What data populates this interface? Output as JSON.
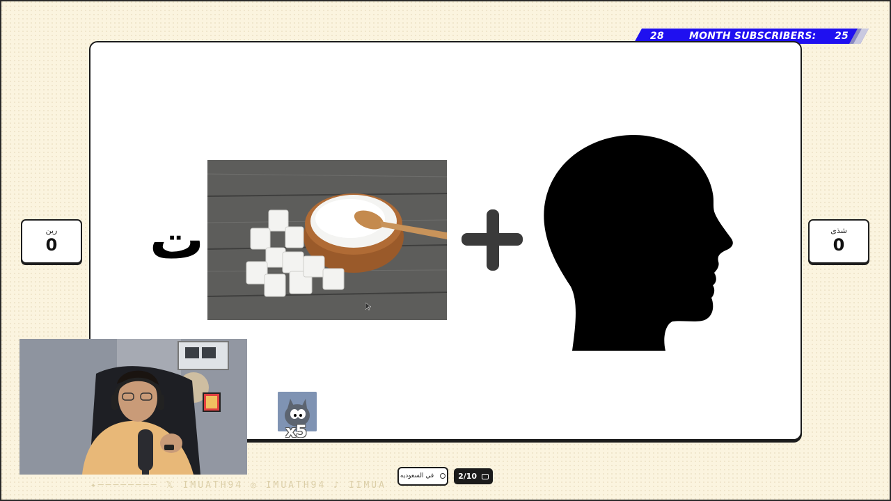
{
  "banner": {
    "left_count": "28",
    "label": "MONTH SUBSCRIBERS:",
    "right_count": "25",
    "color": "#1f10f0"
  },
  "players": [
    {
      "name": "رين",
      "score": "0"
    },
    {
      "name": "شذى",
      "score": "0"
    }
  ],
  "puzzle": {
    "letter": "ت",
    "operator": "+",
    "image_1": "sugar-bowl-with-spoon-and-cubes",
    "image_2": "human-head-silhouette"
  },
  "sticker": {
    "count": "x5"
  },
  "footer": {
    "social": [
      "IMUATH94",
      "IMUATH94",
      "IIMUA"
    ],
    "country_label": "في السعوديه",
    "progress": "2/10"
  }
}
